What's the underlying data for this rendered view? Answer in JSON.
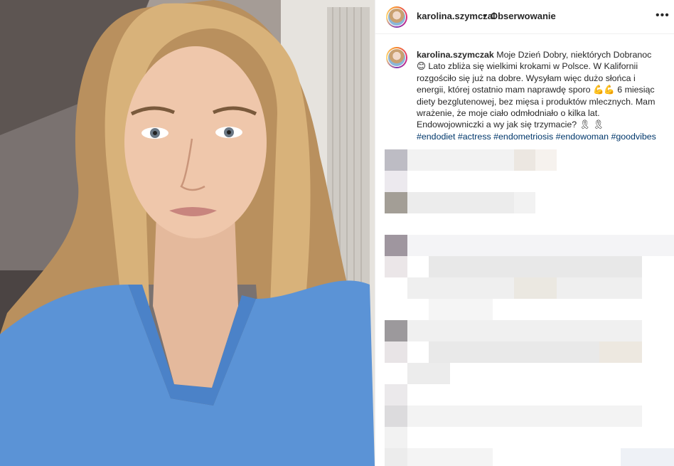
{
  "post": {
    "username": "karolina.szymczak",
    "header_username": "karolina.szymczal",
    "separator": "•",
    "follow_label": "Obserwowanie",
    "more_icon": "•••",
    "caption": "Moje Dzień Dobry, niektórych Dobranoc 😊 Lato zbliża się wielkimi krokami w Polsce. W Kalifornii rozgościło się już na dobre. Wysyłam więc dużo słońca i energii, której ostatnio mam naprawdę sporo 💪💪 6 miesiąc diety bezglutenowej, bez mięsa i produktów mlecznych. Mam wrażenie, że moje ciało odmłodniało o kilka lat. Endowojowniczki a wy jak się trzymacie? 🎗 🎗",
    "hashtags": "#endodiet #actress #endometriosis #endowoman #goodvibes"
  },
  "colors": {
    "shirt": "#5b93d6",
    "hashtag": "#00376b",
    "divider": "#efefef"
  }
}
